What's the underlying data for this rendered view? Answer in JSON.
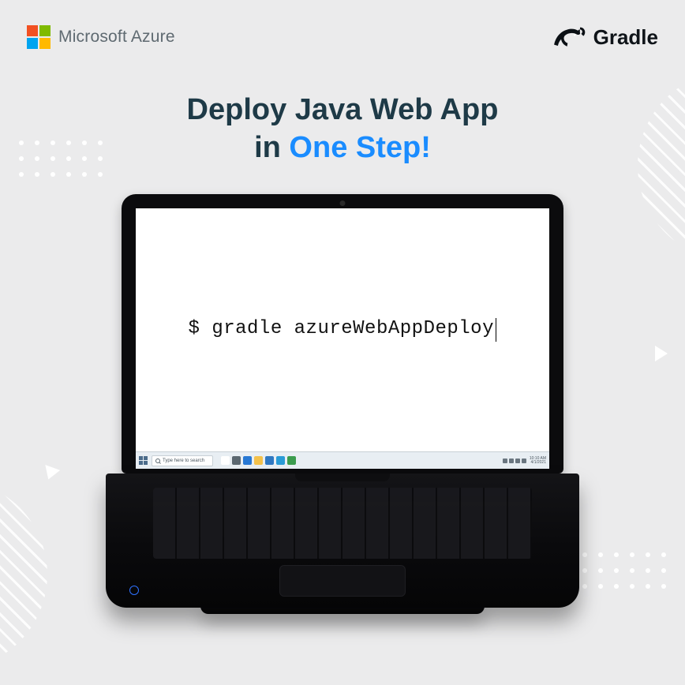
{
  "logos": {
    "azure_text": "Microsoft Azure",
    "gradle_text": "Gradle"
  },
  "headline": {
    "line1": "Deploy Java Web App",
    "line2_prefix": "in ",
    "line2_accent": "One Step!"
  },
  "terminal": {
    "command": "$ gradle azureWebAppDeploy"
  },
  "taskbar": {
    "search_placeholder": "Type here to search",
    "icon_colors": {
      "cortana": "#ffffff",
      "taskview": "#5b6770",
      "edge": "#2778d4",
      "explorer": "#f3c14b",
      "mail": "#2f78c2",
      "store": "#2a9bd6",
      "shield": "#3b9c4e"
    },
    "time": "10:10 AM",
    "date": "4/1/2021"
  }
}
